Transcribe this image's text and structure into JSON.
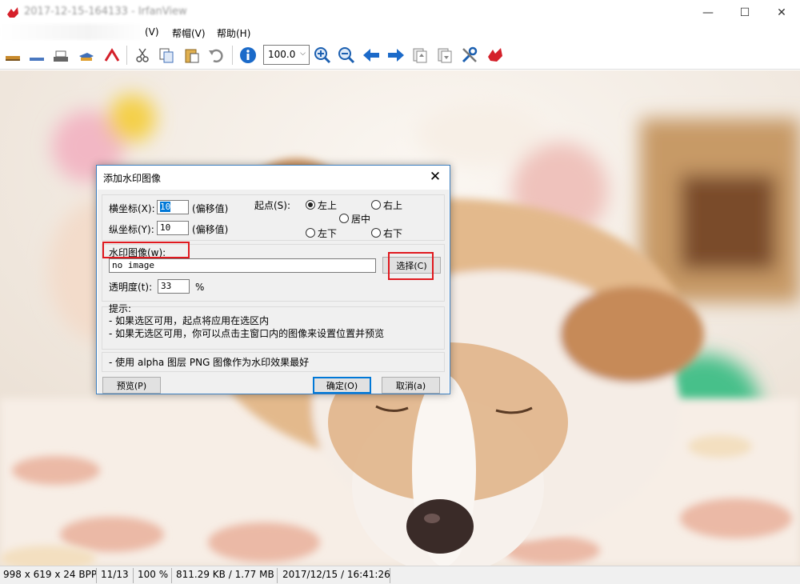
{
  "window": {
    "title": "2017-12-15-164133 - IrfanView",
    "minimize": "—",
    "maximize": "☐",
    "close": "✕"
  },
  "menu": {
    "items": [
      "(V)",
      "帮帽(V)",
      "帮助(H)"
    ]
  },
  "toolbar": {
    "zoom_value": "100.0",
    "icons": [
      "open-icon",
      "save-icon",
      "print-icon",
      "delete-icon",
      "cut-icon",
      "copy-icon",
      "paste-icon",
      "undo-icon",
      "info-icon",
      "zoom-in-icon",
      "zoom-out-icon",
      "prev-icon",
      "next-icon",
      "first-page-icon",
      "last-page-icon",
      "settings-icon",
      "irfanview-icon"
    ]
  },
  "dialog": {
    "title": "添加水印图像",
    "x_label": "横坐标(X):",
    "x_value": "10",
    "x_suffix": "(偏移值)",
    "y_label": "纵坐标(Y):",
    "y_value": "10",
    "y_suffix": "(偏移值)",
    "origin_label": "起点(S):",
    "origin_options": [
      "左上",
      "右上",
      "居中",
      "左下",
      "右下"
    ],
    "origin_selected": "左上",
    "image_label": "水印图像(w):",
    "image_value": "no image",
    "choose_button": "选择(C)",
    "opacity_label": "透明度(t):",
    "opacity_value": "33",
    "opacity_unit": "%",
    "tips_title": "提示:",
    "tip1": "- 如果选区可用，起点将应用在选区内",
    "tip2": "- 如果无选区可用，你可以点击主窗口内的图像来设置位置并预览",
    "tip3": "- 使用 alpha 图层 PNG 图像作为水印效果最好",
    "preview_button": "预览(P)",
    "ok_button": "确定(O)",
    "cancel_button": "取消(a)"
  },
  "status": {
    "dimensions": "998 x 619 x 24 BPP",
    "index": "11/13",
    "zoom": "100 %",
    "size": "811.29 KB / 1.77 MB",
    "datetime": "2017/12/15 / 16:41:26"
  },
  "colors": {
    "accent": "#0078d7",
    "highlight": "#e0191f"
  }
}
